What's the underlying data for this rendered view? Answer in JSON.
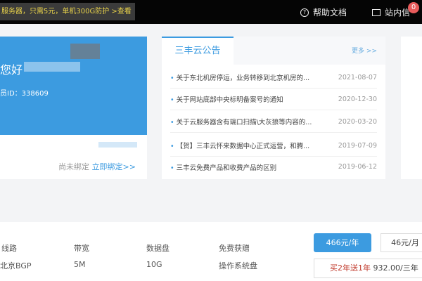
{
  "topbar": {
    "promo": "服务器，只需5元，单机300G防护 >查看",
    "help": "帮助文档",
    "messages": "站内信",
    "badge": "0"
  },
  "user": {
    "greeting": "您好",
    "member_id": "员ID：338609",
    "bind_status": "尚未绑定",
    "bind_link": "立即绑定>>"
  },
  "notices": {
    "tab": "三丰云公告",
    "more": "更多 >>",
    "items": [
      {
        "title": "关于东北机房停运，业务转移到北京机房的...",
        "date": "2021-08-07"
      },
      {
        "title": "关于网站底部中央标明备案号的通知",
        "date": "2020-12-30"
      },
      {
        "title": "关于云服务器含有端口扫描\\大灰狼等内容的...",
        "date": "2020-03-20"
      },
      {
        "title": "【贺】三丰云怀来数据中心正式运营，和腾...",
        "date": "2019-07-09"
      },
      {
        "title": "三丰云免费产品和收费产品的区别",
        "date": "2019-06-12"
      }
    ]
  },
  "product": {
    "columns": [
      {
        "label": "线路",
        "value": "北京BGP"
      },
      {
        "label": "带宽",
        "value": "5M"
      },
      {
        "label": "数据盘",
        "value": "10G"
      },
      {
        "label": "免费获赠",
        "value": "操作系统盘"
      }
    ],
    "price_year": "466元/年",
    "price_month": "46元/月",
    "promo_red": "买2年送1年",
    "promo_price": "932.00/三年"
  }
}
